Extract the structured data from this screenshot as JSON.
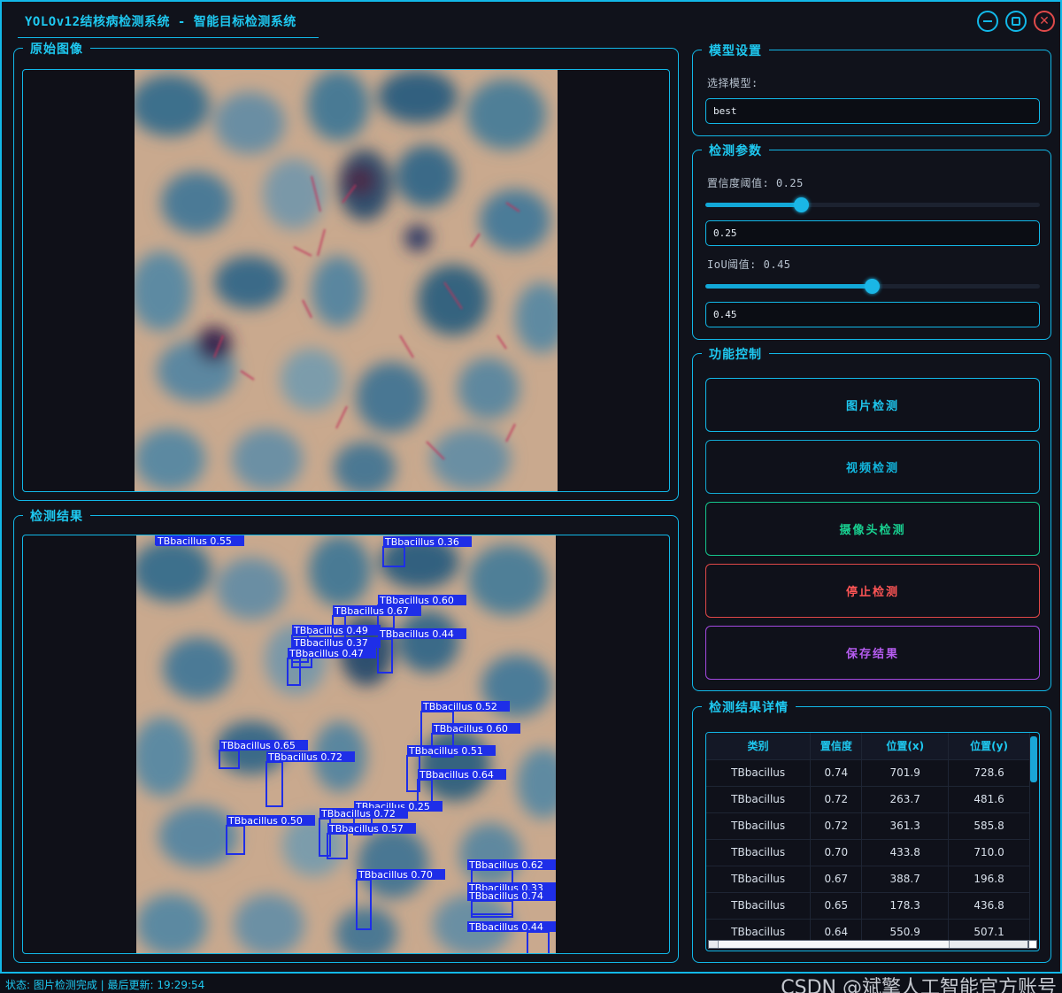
{
  "window": {
    "title": "YOLOv12结核病检测系统 - 智能目标检测系统",
    "buttons": {
      "minimize": "minimize-icon",
      "maximize": "maximize-icon",
      "close": "close-icon"
    }
  },
  "left": {
    "original_title": "原始图像",
    "result_title": "检测结果",
    "detections": [
      {
        "label": "TBbacillus 0.55"
      },
      {
        "label": "TBbacillus 0.36"
      },
      {
        "label": "TBbacillus 0.60"
      },
      {
        "label": "TBbacillus 0.67"
      },
      {
        "label": "TBbacillus 0.49"
      },
      {
        "label": "TBbacillus 0.44"
      },
      {
        "label": "TBbacillus 0.37"
      },
      {
        "label": "TBbacillus 0.47"
      },
      {
        "label": "TBbacillus 0.52"
      },
      {
        "label": "TBbacillus 0.60"
      },
      {
        "label": "TBbacillus 0.65"
      },
      {
        "label": "TBbacillus 0.72"
      },
      {
        "label": "TBbacillus 0.51"
      },
      {
        "label": "TBbacillus 0.64"
      },
      {
        "label": "TBbacillus 0.25"
      },
      {
        "label": "TBbacillus 0.72"
      },
      {
        "label": "TBbacillus 0.50"
      },
      {
        "label": "TBbacillus 0.57"
      },
      {
        "label": "TBbacillus 0.62"
      },
      {
        "label": "TBbacillus 0.70"
      },
      {
        "label": "TBbacillus 0.33"
      },
      {
        "label": "TBbacillus 0.74"
      },
      {
        "label": "TBbacillus 0.44"
      }
    ]
  },
  "model": {
    "title": "模型设置",
    "select_label": "选择模型:",
    "selected": "best"
  },
  "params": {
    "title": "检测参数",
    "conf_label": "置信度阈值: 0.25",
    "conf_value": "0.25",
    "conf_fraction": 0.25,
    "iou_label": "IoU阈值: 0.45",
    "iou_value": "0.45",
    "iou_fraction": 0.45
  },
  "controls": {
    "title": "功能控制",
    "image_detect": "图片检测",
    "video_detect": "视频检测",
    "camera_detect": "摄像头检测",
    "stop_detect": "停止检测",
    "save_result": "保存结果"
  },
  "results": {
    "title": "检测结果详情",
    "columns": [
      "类别",
      "置信度",
      "位置(x)",
      "位置(y)"
    ],
    "rows": [
      [
        "TBbacillus",
        "0.74",
        "701.9",
        "728.6"
      ],
      [
        "TBbacillus",
        "0.72",
        "263.7",
        "481.6"
      ],
      [
        "TBbacillus",
        "0.72",
        "361.3",
        "585.8"
      ],
      [
        "TBbacillus",
        "0.70",
        "433.8",
        "710.0"
      ],
      [
        "TBbacillus",
        "0.67",
        "388.7",
        "196.8"
      ],
      [
        "TBbacillus",
        "0.65",
        "178.3",
        "436.8"
      ],
      [
        "TBbacillus",
        "0.64",
        "550.9",
        "507.1"
      ]
    ]
  },
  "status": {
    "text": "状态: 图片检测完成 | 最后更新: 19:29:54",
    "watermark": "CSDN @斌擎人工智能官方账号"
  }
}
